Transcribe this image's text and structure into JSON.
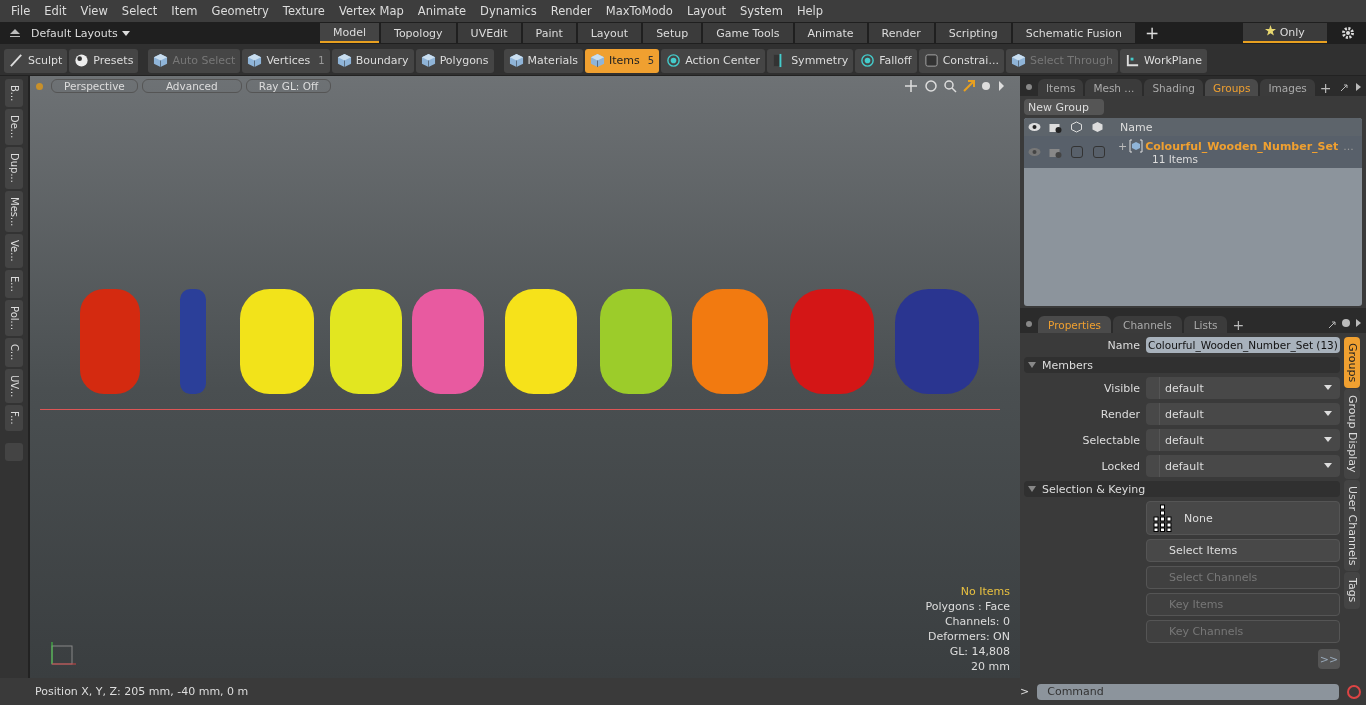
{
  "menu": [
    "File",
    "Edit",
    "View",
    "Select",
    "Item",
    "Geometry",
    "Texture",
    "Vertex Map",
    "Animate",
    "Dynamics",
    "Render",
    "MaxToModo",
    "Layout",
    "System",
    "Help"
  ],
  "layout_bar": {
    "layout_menu": "Default Layouts",
    "tabs": [
      {
        "label": "Model",
        "selected": true
      },
      {
        "label": "Topology",
        "selected": false
      },
      {
        "label": "UVEdit",
        "selected": false
      },
      {
        "label": "Paint",
        "selected": false
      },
      {
        "label": "Layout",
        "selected": false
      },
      {
        "label": "Setup",
        "selected": false
      },
      {
        "label": "Game Tools",
        "selected": false
      },
      {
        "label": "Animate",
        "selected": false
      },
      {
        "label": "Render",
        "selected": false
      },
      {
        "label": "Scripting",
        "selected": false
      },
      {
        "label": "Schematic Fusion",
        "selected": false
      }
    ],
    "add": "+",
    "only": "Only"
  },
  "toolbar": [
    {
      "label": "Sculpt",
      "kind": "brush",
      "disabled": false,
      "selected": false
    },
    {
      "label": "Presets",
      "kind": "ball",
      "disabled": false,
      "selected": false
    },
    {
      "label": "Auto Select",
      "kind": "cube",
      "disabled": true,
      "selected": false
    },
    {
      "label": "Vertices",
      "kind": "cube",
      "disabled": false,
      "selected": false,
      "count": "1"
    },
    {
      "label": "Boundary",
      "kind": "cube",
      "disabled": false,
      "selected": false
    },
    {
      "label": "Polygons",
      "kind": "cube",
      "disabled": false,
      "selected": false
    },
    {
      "label": "Materials",
      "kind": "cube",
      "disabled": false,
      "selected": false
    },
    {
      "label": "Items",
      "kind": "cube",
      "disabled": false,
      "selected": true,
      "count": "5"
    },
    {
      "label": "Action Center",
      "kind": "target",
      "disabled": false,
      "selected": false
    },
    {
      "label": "Symmetry",
      "kind": "bar",
      "disabled": false,
      "selected": false
    },
    {
      "label": "Falloff",
      "kind": "target",
      "disabled": false,
      "selected": false
    },
    {
      "label": "Constrai...",
      "kind": "window",
      "disabled": false,
      "selected": false
    },
    {
      "label": "Select Through",
      "kind": "cube",
      "disabled": true,
      "selected": false
    },
    {
      "label": "WorkPlane",
      "kind": "grid",
      "disabled": false,
      "selected": false
    }
  ],
  "left_strip": [
    "B...",
    "De...",
    "Dup...",
    "Mes...",
    "Ve...",
    "E...",
    "Pol...",
    "C...",
    "UV...",
    "F..."
  ],
  "viewport": {
    "buttons": [
      "Perspective",
      "Advanced",
      "Ray GL: Off"
    ],
    "info": [
      {
        "text": "No Items",
        "highlight": true
      },
      {
        "text": "Polygons : Face",
        "highlight": false
      },
      {
        "text": "Channels: 0",
        "highlight": false
      },
      {
        "text": "Deformers: ON",
        "highlight": false
      },
      {
        "text": "GL: 14,808",
        "highlight": false
      },
      {
        "text": "20 mm",
        "highlight": false
      }
    ]
  },
  "status_bar": "Position X, Y, Z:  205 mm, -40 mm, 0 m",
  "groups_panel": {
    "tabs": [
      {
        "label": "Items",
        "selected": false
      },
      {
        "label": "Mesh ...",
        "selected": false
      },
      {
        "label": "Shading",
        "selected": false
      },
      {
        "label": "Groups",
        "selected": true
      },
      {
        "label": "Images",
        "selected": false
      }
    ],
    "add": "+",
    "new_group": "New Group",
    "column": "Name",
    "rows": [
      {
        "name": "Colourful_Wooden_Number_Set",
        "more": "...",
        "count": "11 Items",
        "expand": "+",
        "toggles": [
          {
            "checked": false
          },
          {
            "checked": false
          }
        ]
      }
    ]
  },
  "properties_panel": {
    "tabs": [
      {
        "label": "Properties",
        "selected": true
      },
      {
        "label": "Channels",
        "selected": false
      },
      {
        "label": "Lists",
        "selected": false
      }
    ],
    "add": "+",
    "name_label": "Name",
    "name_value": "Colourful_Wooden_Number_Set (13)",
    "members_title": "Members",
    "members": [
      {
        "label": "Visible",
        "value": "default"
      },
      {
        "label": "Render",
        "value": "default"
      },
      {
        "label": "Selectable",
        "value": "default"
      },
      {
        "label": "Locked",
        "value": "default"
      }
    ],
    "keying_title": "Selection & Keying",
    "none_button": "None",
    "buttons": [
      {
        "label": "Select Items",
        "disabled": false
      },
      {
        "label": "Select Channels",
        "disabled": true
      },
      {
        "label": "Key Items",
        "disabled": true
      },
      {
        "label": "Key Channels",
        "disabled": true
      }
    ],
    "more": ">>",
    "side_tabs": [
      {
        "label": "Groups",
        "selected": true
      },
      {
        "label": "Group Display",
        "selected": false
      },
      {
        "label": "User Channels",
        "selected": false
      },
      {
        "label": "Tags",
        "selected": false
      }
    ]
  },
  "command": {
    "prompt": ">",
    "placeholder": "Command"
  }
}
